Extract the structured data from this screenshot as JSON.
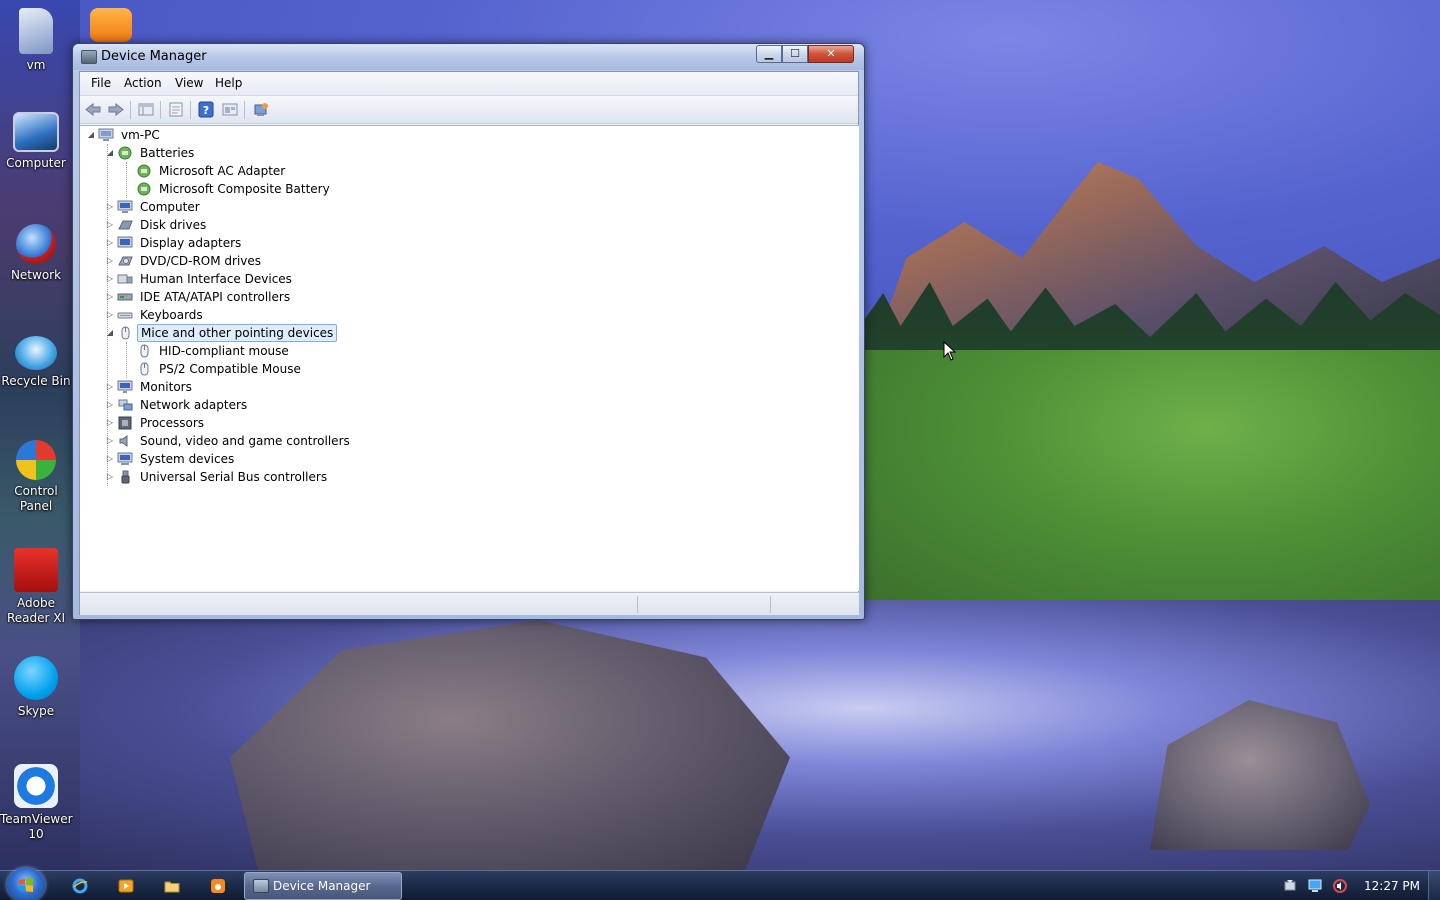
{
  "desktop": {
    "icons": [
      {
        "label": "vm"
      },
      {
        "label": "Computer"
      },
      {
        "label": "Network"
      },
      {
        "label": "Recycle Bin"
      },
      {
        "label": "Control Panel"
      },
      {
        "label": "Adobe Reader XI"
      },
      {
        "label": "Skype"
      },
      {
        "label": "TeamViewer 10"
      }
    ]
  },
  "window": {
    "title": "Device Manager",
    "controls": {
      "minimize": "▁",
      "maximize": "☐",
      "close": "✕"
    },
    "menu": [
      "File",
      "Action",
      "View",
      "Help"
    ],
    "toolbar": [
      "back-arrow",
      "forward-arrow",
      "show-hide-tree",
      "properties",
      "help",
      "scan-hardware",
      "update-driver"
    ],
    "tree": {
      "root": "vm-PC",
      "categories": [
        {
          "label": "Batteries",
          "expanded": true,
          "children": [
            "Microsoft AC Adapter",
            "Microsoft Composite Battery"
          ]
        },
        {
          "label": "Computer"
        },
        {
          "label": "Disk drives"
        },
        {
          "label": "Display adapters"
        },
        {
          "label": "DVD/CD-ROM drives"
        },
        {
          "label": "Human Interface Devices"
        },
        {
          "label": "IDE ATA/ATAPI controllers"
        },
        {
          "label": "Keyboards"
        },
        {
          "label": "Mice and other pointing devices",
          "expanded": true,
          "selected": true,
          "children": [
            "HID-compliant mouse",
            "PS/2 Compatible Mouse"
          ]
        },
        {
          "label": "Monitors"
        },
        {
          "label": "Network adapters"
        },
        {
          "label": "Processors"
        },
        {
          "label": "Sound, video and game controllers"
        },
        {
          "label": "System devices"
        },
        {
          "label": "Universal Serial Bus controllers"
        }
      ]
    }
  },
  "taskbar": {
    "active_task": "Device Manager",
    "clock": "12:27 PM"
  }
}
